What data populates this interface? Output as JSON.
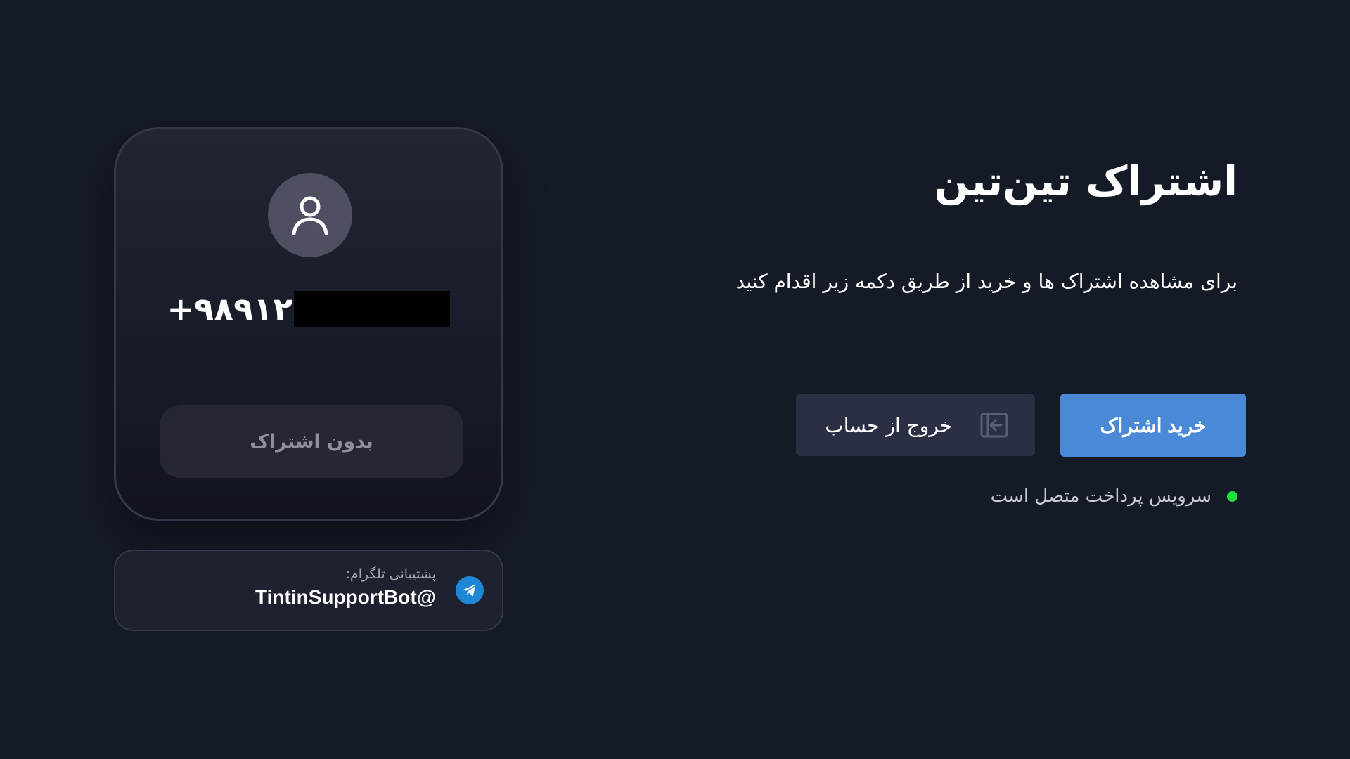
{
  "profile": {
    "avatar_icon": "user-icon",
    "phone_visible": "+۹۸۹۱۲",
    "subscription_status": "بدون اشتراک"
  },
  "support": {
    "label": "پشتیبانی تلگرام:",
    "handle": "TintinSupportBot@",
    "icon": "telegram-icon"
  },
  "main": {
    "title": "اشتراک تین‌تین",
    "description": "برای مشاهده اشتراک ها و خرید از طریق دکمه زیر اقدام کنید",
    "buy_label": "خرید اشتراک",
    "logout_label": "خروج از حساب",
    "logout_icon": "logout-icon",
    "payment_status": "سرویس پرداخت متصل است"
  },
  "colors": {
    "background": "#151a27",
    "primary": "#4a89d6",
    "secondary_button": "#2a2f43",
    "status_ok": "#1fe23d",
    "telegram": "#1e88d6"
  }
}
